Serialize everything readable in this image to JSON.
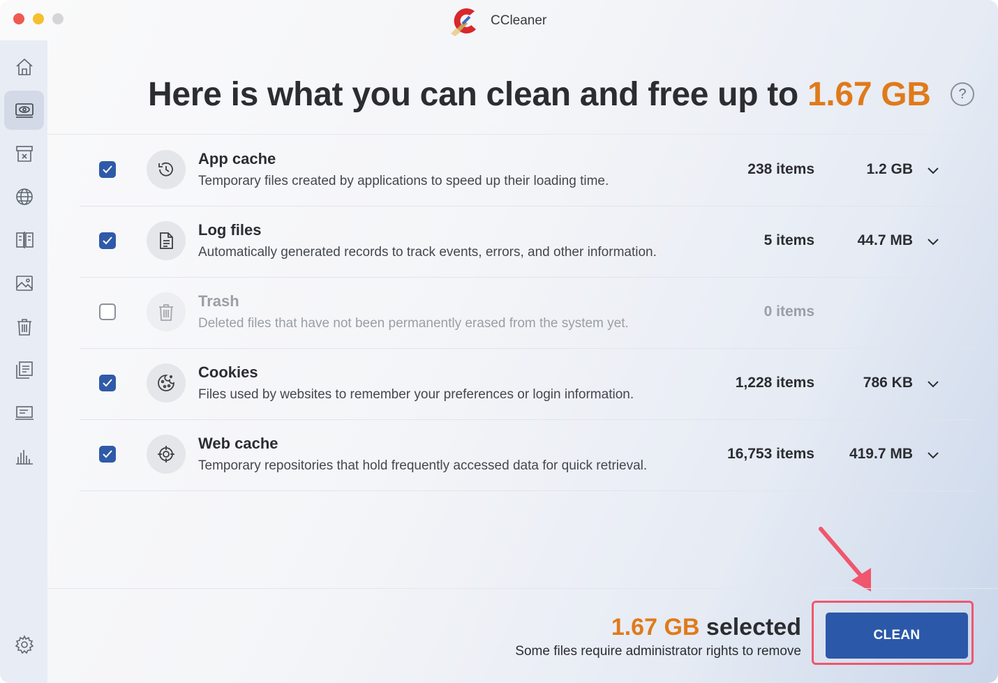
{
  "window": {
    "title": "CCleaner"
  },
  "headline": {
    "prefix": "Here is what you can clean and free up to",
    "size": "1.67 GB"
  },
  "help": {
    "label": "?"
  },
  "sidebar": {
    "items": [
      {
        "icon": "home-icon"
      },
      {
        "icon": "cleaner-icon",
        "active": true
      },
      {
        "icon": "archive-icon"
      },
      {
        "icon": "globe-icon"
      },
      {
        "icon": "duplicate-finder-icon"
      },
      {
        "icon": "photo-icon"
      },
      {
        "icon": "trash-icon"
      },
      {
        "icon": "uninstaller-icon"
      },
      {
        "icon": "device-icon"
      },
      {
        "icon": "stats-icon"
      },
      {
        "icon": "settings-icon"
      }
    ]
  },
  "rows": [
    {
      "title": "App cache",
      "desc": "Temporary files created by applications to speed up their loading time.",
      "count": "238 items",
      "size": "1.2 GB",
      "checked": true,
      "icon": "history-icon"
    },
    {
      "title": "Log files",
      "desc": "Automatically generated records to track events, errors, and other information.",
      "count": "5 items",
      "size": "44.7 MB",
      "checked": true,
      "icon": "document-icon"
    },
    {
      "title": "Trash",
      "desc": "Deleted files that have not been permanently erased from the system yet.",
      "count": "0 items",
      "size": "",
      "checked": false,
      "icon": "trash-icon"
    },
    {
      "title": "Cookies",
      "desc": "Files used by websites to remember your preferences or login information.",
      "count": "1,228 items",
      "size": "786 KB",
      "checked": true,
      "icon": "cookie-icon"
    },
    {
      "title": "Web cache",
      "desc": "Temporary repositories that hold frequently accessed data for quick retrieval.",
      "count": "16,753 items",
      "size": "419.7 MB",
      "checked": true,
      "icon": "crosshair-icon"
    }
  ],
  "footer": {
    "selected_size": "1.67 GB",
    "selected_word": "selected",
    "admin_note": "Some files require administrator rights to remove",
    "clean_label": "CLEAN"
  },
  "colors": {
    "accent": "#e07a1a",
    "primary": "#2b58a8",
    "highlight": "#f0566d"
  }
}
